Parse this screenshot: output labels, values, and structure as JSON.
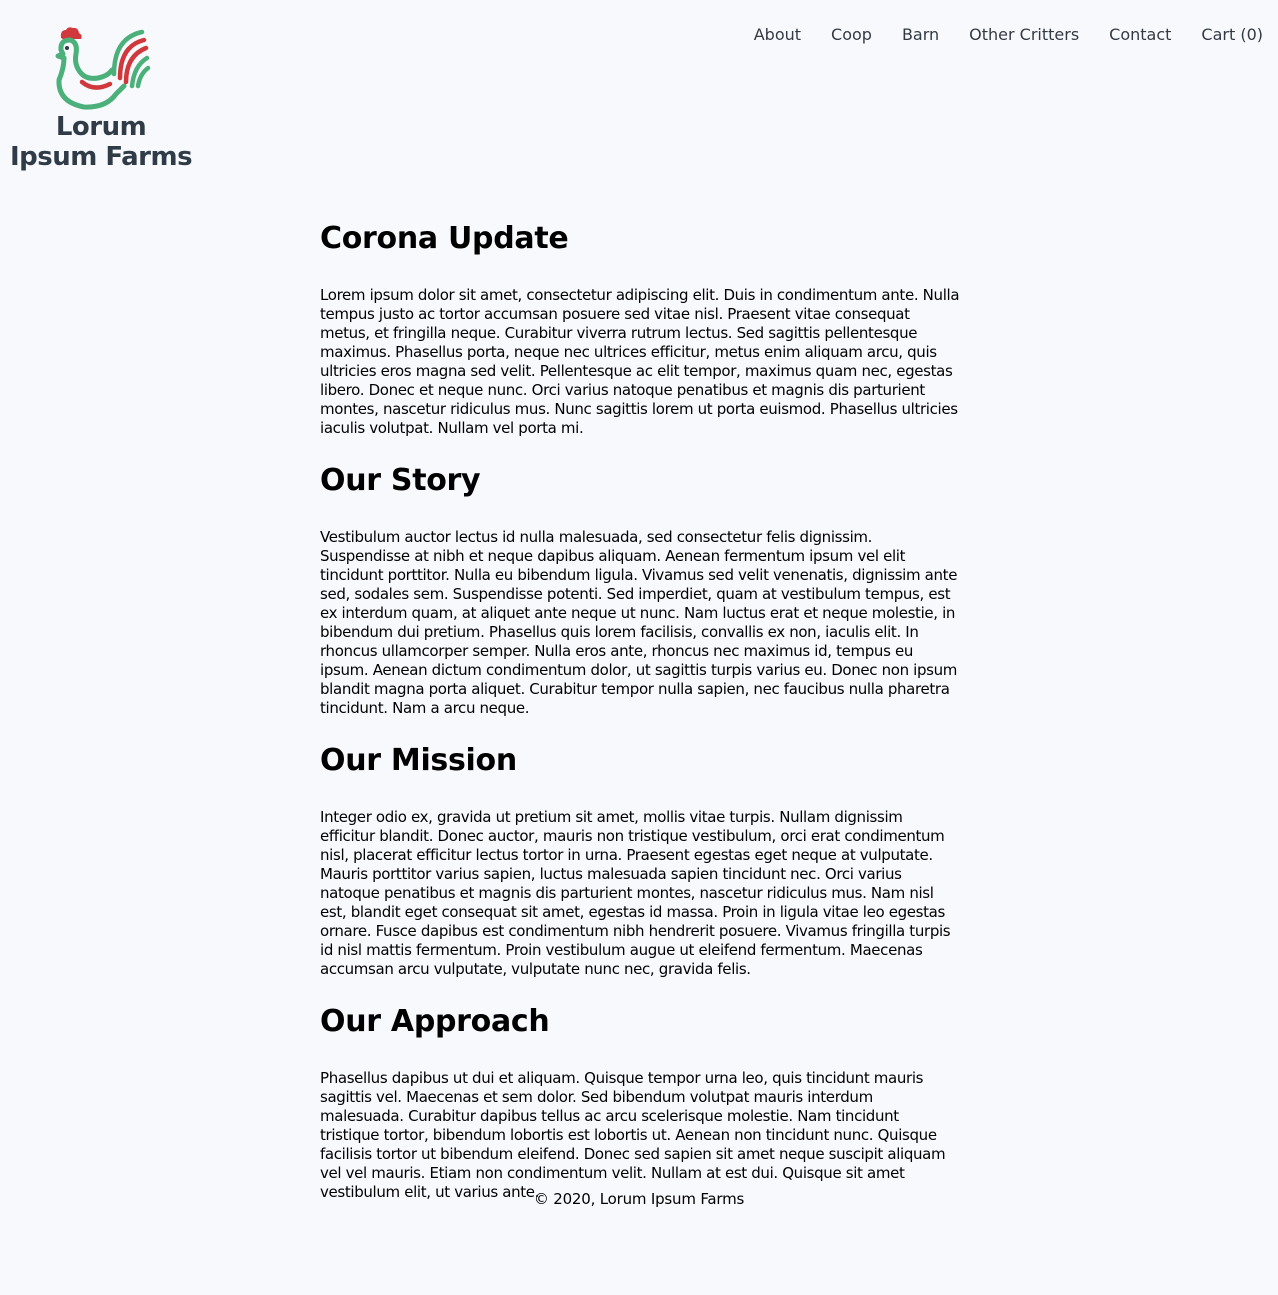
{
  "brand": {
    "line1": "Lorum",
    "line2": "Ipsum Farms",
    "colors": {
      "green": "#4cb07a",
      "red": "#d0383b",
      "text": "#2f3b47"
    }
  },
  "nav": [
    {
      "label": "About"
    },
    {
      "label": "Coop"
    },
    {
      "label": "Barn"
    },
    {
      "label": "Other Critters"
    },
    {
      "label": "Contact"
    },
    {
      "label": "Cart (0)"
    }
  ],
  "sections": [
    {
      "title": "Corona Update",
      "body": "Lorem ipsum dolor sit amet, consectetur adipiscing elit. Duis in condimentum ante. Nulla tempus justo ac tortor accumsan posuere sed vitae nisl. Praesent vitae consequat metus, et fringilla neque. Curabitur viverra rutrum lectus. Sed sagittis pellentesque maximus. Phasellus porta, neque nec ultrices efficitur, metus enim aliquam arcu, quis ultricies eros magna sed velit. Pellentesque ac elit tempor, maximus quam nec, egestas libero. Donec et neque nunc. Orci varius natoque penatibus et magnis dis parturient montes, nascetur ridiculus mus. Nunc sagittis lorem ut porta euismod. Phasellus ultricies iaculis volutpat. Nullam vel porta mi."
    },
    {
      "title": "Our Story",
      "body": "Vestibulum auctor lectus id nulla malesuada, sed consectetur felis dignissim. Suspendisse at nibh et neque dapibus aliquam. Aenean fermentum ipsum vel elit tincidunt porttitor. Nulla eu bibendum ligula. Vivamus sed velit venenatis, dignissim ante sed, sodales sem. Suspendisse potenti. Sed imperdiet, quam at vestibulum tempus, est ex interdum quam, at aliquet ante neque ut nunc. Nam luctus erat et neque molestie, in bibendum dui pretium. Phasellus quis lorem facilisis, convallis ex non, iaculis elit. In rhoncus ullamcorper semper. Nulla eros ante, rhoncus nec maximus id, tempus eu ipsum. Aenean dictum condimentum dolor, ut sagittis turpis varius eu. Donec non ipsum blandit magna porta aliquet. Curabitur tempor nulla sapien, nec faucibus nulla pharetra tincidunt. Nam a arcu neque."
    },
    {
      "title": "Our Mission",
      "body": "Integer odio ex, gravida ut pretium sit amet, mollis vitae turpis. Nullam dignissim efficitur blandit. Donec auctor, mauris non tristique vestibulum, orci erat condimentum nisl, placerat efficitur lectus tortor in urna. Praesent egestas eget neque at vulputate. Mauris porttitor varius sapien, luctus malesuada sapien tincidunt nec. Orci varius natoque penatibus et magnis dis parturient montes, nascetur ridiculus mus. Nam nisl est, blandit eget consequat sit amet, egestas id massa. Proin in ligula vitae leo egestas ornare. Fusce dapibus est condimentum nibh hendrerit posuere. Vivamus fringilla turpis id nisl mattis fermentum. Proin vestibulum augue ut eleifend fermentum. Maecenas accumsan arcu vulputate, vulputate nunc nec, gravida felis."
    },
    {
      "title": "Our Approach",
      "body": "Phasellus dapibus ut dui et aliquam. Quisque tempor urna leo, quis tincidunt mauris sagittis vel. Maecenas et sem dolor. Sed bibendum volutpat mauris interdum malesuada. Curabitur dapibus tellus ac arcu scelerisque molestie. Nam tincidunt tristique tortor, bibendum lobortis est lobortis ut. Aenean non tincidunt nunc. Quisque facilisis tortor ut bibendum eleifend. Donec sed sapien sit amet neque suscipit aliquam vel vel mauris. Etiam non condimentum velit. Nullam at est dui. Quisque sit amet vestibulum elit, ut varius ante."
    }
  ],
  "footer": {
    "text": "© 2020, Lorum Ipsum Farms"
  }
}
